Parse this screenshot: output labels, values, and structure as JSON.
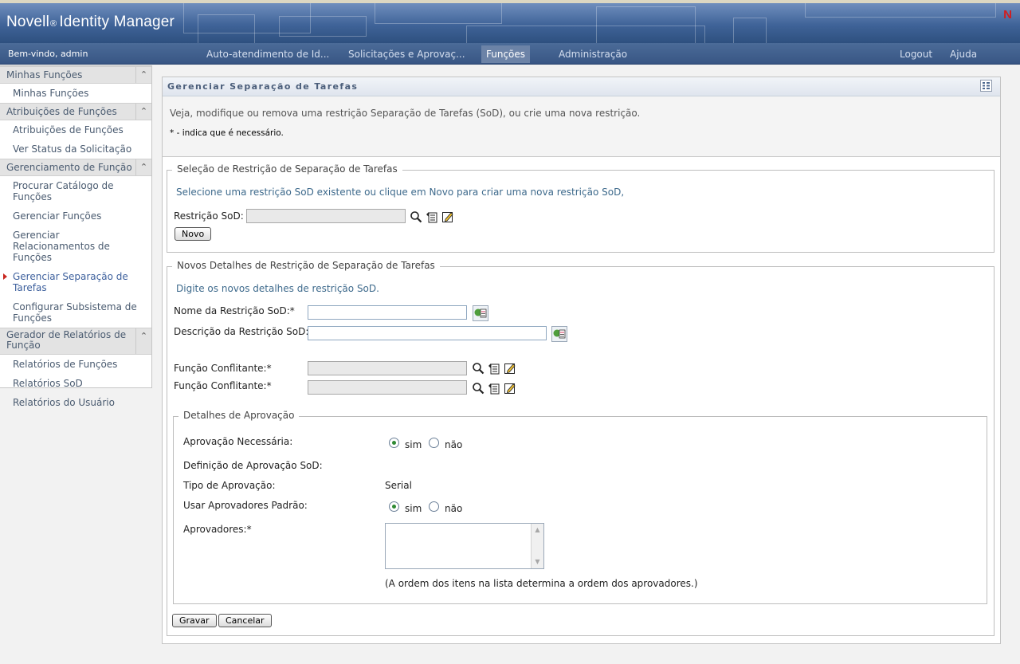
{
  "header": {
    "brand": "Novell",
    "brand_reg": "®",
    "product": "Identity Manager",
    "logo_letter": "N",
    "welcome": "Bem-vindo, admin"
  },
  "nav": {
    "tabs": [
      {
        "label": "Auto-atendimento de Id..."
      },
      {
        "label": "Solicitações e Aprovaç..."
      },
      {
        "label": "Funções"
      },
      {
        "label": "Administração"
      }
    ],
    "active_index": 2,
    "logout": "Logout",
    "help": "Ajuda"
  },
  "sidebar": {
    "groups": [
      {
        "title": "Minhas Funções",
        "items": [
          "Minhas Funções"
        ]
      },
      {
        "title": "Atribuições de Funções",
        "items": [
          "Atribuições de Funções",
          "Ver Status da Solicitação"
        ]
      },
      {
        "title": "Gerenciamento de Função",
        "items": [
          "Procurar Catálogo de Funções",
          "Gerenciar Funções",
          "Gerenciar Relacionamentos de Funções",
          "Gerenciar Separação de Tarefas",
          "Configurar Subsistema de Funções"
        ]
      },
      {
        "title": "Gerador de Relatórios de Função",
        "items": [
          "Relatórios de Funções",
          "Relatórios SoD",
          "Relatórios do Usuário"
        ]
      }
    ],
    "active_item": "Gerenciar Separação de Tarefas"
  },
  "page": {
    "title": "Gerenciar Separação de Tarefas",
    "description": "Veja, modifique ou remova uma restrição Separação de Tarefas (SoD), ou crie uma nova restrição.",
    "required_note": "* - indica que é necessário."
  },
  "selection": {
    "legend": "Seleção de Restrição de Separação de Tarefas",
    "hint": "Selecione uma restrição SoD existente ou clique em Novo para criar uma nova restrição SoD,",
    "field_label": "Restrição SoD:",
    "field_value": "",
    "new_button": "Novo"
  },
  "details": {
    "legend": "Novos Detalhes de Restrição de Separação de Tarefas",
    "hint": "Digite os novos detalhes de restrição SoD.",
    "name_label": "Nome da Restrição SoD:*",
    "name_value": "",
    "desc_label": "Descrição da Restrição SoD:*",
    "desc_value": "",
    "conflict1_label": "Função Conflitante:*",
    "conflict1_value": "",
    "conflict2_label": "Função Conflitante:*",
    "conflict2_value": ""
  },
  "approval": {
    "legend": "Detalhes de Aprovação",
    "required_label": "Aprovação Necessária:",
    "yes": "sim",
    "no": "não",
    "required_value": "sim",
    "definition_label": "Definição de Aprovação SoD:",
    "type_label": "Tipo de Aprovação:",
    "type_value": "Serial",
    "default_label": "Usar Aprovadores Padrão:",
    "default_value": "sim",
    "approvers_label": "Aprovadores:*",
    "approvers": [],
    "order_note": "(A ordem dos itens na lista determina a ordem dos aprovadores.)"
  },
  "actions": {
    "save": "Gravar",
    "cancel": "Cancelar"
  }
}
